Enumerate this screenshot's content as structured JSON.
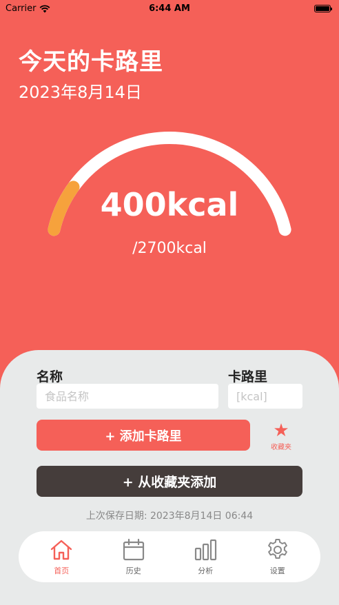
{
  "status_bar": {
    "carrier": "Carrier",
    "time": "6:44 AM"
  },
  "header": {
    "title": "今天的卡路里",
    "date": "2023年8月14日"
  },
  "gauge": {
    "value_label": "400kcal",
    "target_label": "/2700kcal",
    "consumed": 400,
    "goal": 2700,
    "track_color": "#ffffff",
    "progress_color": "#f6a23c"
  },
  "form": {
    "name_label": "名称",
    "name_placeholder": "食品名称",
    "calorie_label": "卡路里",
    "calorie_placeholder": "[kcal]",
    "add_button": "+ 添加卡路里",
    "favorites_label": "收藏夹",
    "add_from_favorites_button": "+ 从收藏夹添加",
    "last_saved": "上次保存日期: 2023年8月14日 06:44"
  },
  "tabs": [
    {
      "label": "首页",
      "icon": "home-icon",
      "active": true
    },
    {
      "label": "历史",
      "icon": "calendar-icon",
      "active": false
    },
    {
      "label": "分析",
      "icon": "bar-chart-icon",
      "active": false
    },
    {
      "label": "设置",
      "icon": "gear-icon",
      "active": false
    }
  ],
  "colors": {
    "accent": "#f56058",
    "dark_button": "#453d3b",
    "panel_bg": "#e8eaea"
  }
}
